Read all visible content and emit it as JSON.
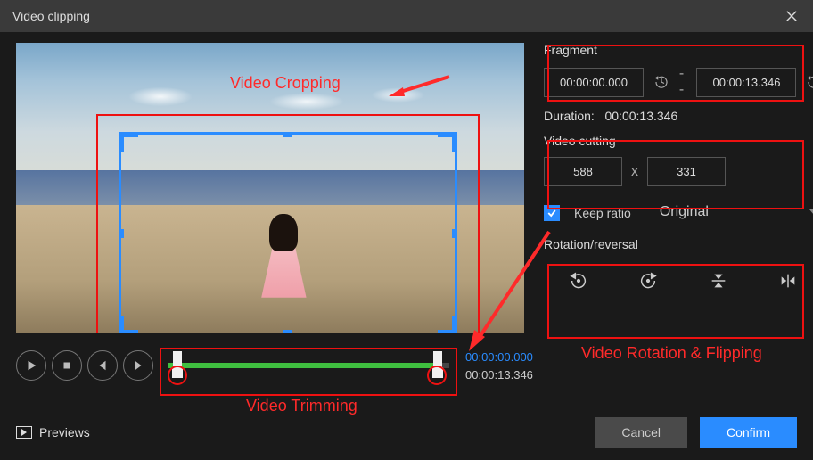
{
  "titlebar": {
    "title": "Video clipping"
  },
  "annotations": {
    "crop_label": "Video Cropping",
    "trim_label": "Video Trimming",
    "rotation_label": "Video Rotation & Flipping"
  },
  "timeline": {
    "start_time": "00:00:00.000",
    "end_time": "00:00:13.346"
  },
  "fragment": {
    "title": "Fragment",
    "start": "00:00:00.000",
    "end": "00:00:13.346",
    "separator": "--",
    "duration_label": "Duration:",
    "duration": "00:00:13.346"
  },
  "cutting": {
    "title": "Video cutting",
    "width": "588",
    "height": "331",
    "separator": "x",
    "keep_ratio_label": "Keep ratio",
    "keep_ratio_checked": true,
    "preset_selected": "Original"
  },
  "rotation": {
    "title": "Rotation/reversal"
  },
  "footer": {
    "previews": "Previews",
    "cancel": "Cancel",
    "confirm": "Confirm"
  }
}
